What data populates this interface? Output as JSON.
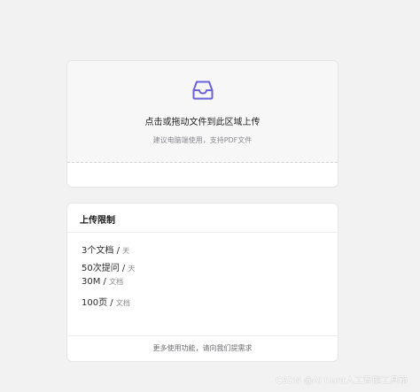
{
  "upload": {
    "icon": "inbox-icon",
    "accent_color": "#6b63d9",
    "title": "点击或拖动文件到此区域上传",
    "hint": "建议电脑端使用，支持PDF文件"
  },
  "limits": {
    "title": "上传限制",
    "items": [
      {
        "value": "3个文档",
        "sep": "/",
        "unit": "天"
      },
      {
        "value": "50次提问",
        "sep": "/",
        "unit": "天"
      },
      {
        "value": "30M",
        "sep": "/",
        "unit": "文档"
      },
      {
        "value": "100页",
        "sep": "/",
        "unit": "文档"
      }
    ],
    "footer": "更多使用功能，请向我们提需求"
  },
  "watermark": "CSDN @AI Hunt人工智能工具箱"
}
